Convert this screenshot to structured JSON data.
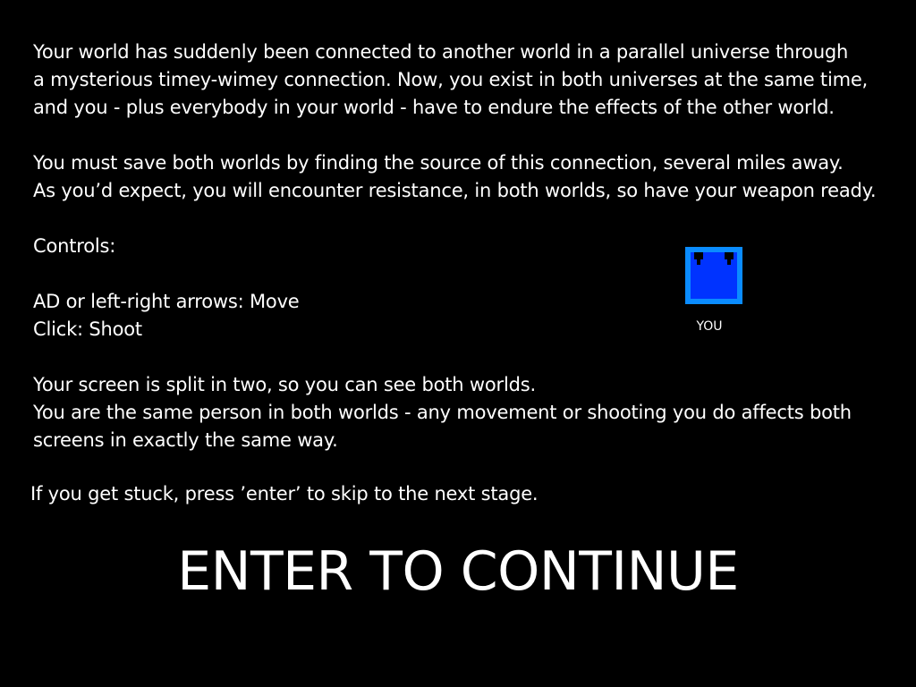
{
  "intro": {
    "paragraph1": [
      "Your world has suddenly been connected to another world in a parallel universe through",
      "a mysterious timey-wimey connection. Now, you exist in both universes at the same time,",
      "and you - plus everybody in your world - have to endure the effects of the other world."
    ],
    "paragraph2": [
      "You must save both worlds by finding the source of this connection, several miles away.",
      "As you’d expect, you will encounter resistance, in both worlds, so have your weapon ready."
    ],
    "controls_heading": "Controls:",
    "controls": [
      "AD or left-right arrows: Move",
      "Click: Shoot"
    ],
    "paragraph3": [
      "Your screen is split in two, so you can see both worlds.",
      "You are the same person in both worlds - any movement or shooting you do affects both",
      "screens in exactly the same way."
    ]
  },
  "skip_hint": "If you get stuck, press ’enter’ to skip to the next stage.",
  "continue_prompt": "ENTER TO CONTINUE",
  "player": {
    "label": "YOU",
    "fill_color": "#0033ff",
    "border_color": "#0a8cff"
  },
  "colors": {
    "background": "#000000",
    "text": "#ffffff"
  }
}
